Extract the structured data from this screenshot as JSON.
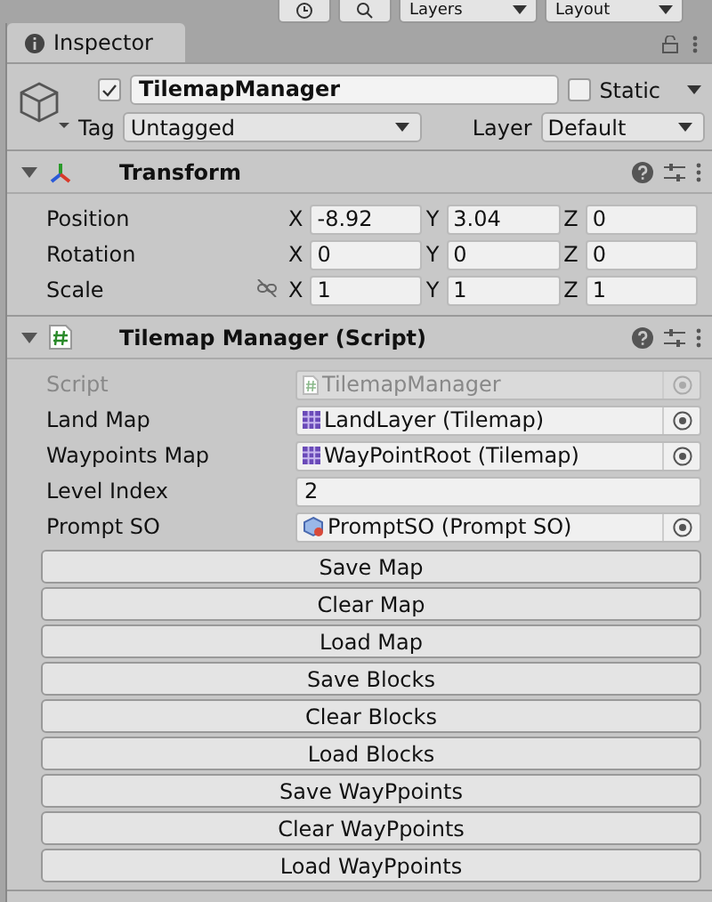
{
  "toolbar": {
    "dropdowns": [
      "Layers",
      "Layout"
    ]
  },
  "tab": {
    "label": "Inspector"
  },
  "object": {
    "active": true,
    "name": "TilemapManager",
    "static": false,
    "static_label": "Static",
    "tag_label": "Tag",
    "tag": "Untagged",
    "layer_label": "Layer",
    "layer": "Default"
  },
  "components": [
    {
      "kind": "transform",
      "title": "Transform",
      "expanded": true,
      "rows": [
        {
          "label": "Position",
          "values": [
            {
              "axis": "X",
              "value": "-8.92"
            },
            {
              "axis": "Y",
              "value": "3.04"
            },
            {
              "axis": "Z",
              "value": "0"
            }
          ]
        },
        {
          "label": "Rotation",
          "values": [
            {
              "axis": "X",
              "value": "0"
            },
            {
              "axis": "Y",
              "value": "0"
            },
            {
              "axis": "Z",
              "value": "0"
            }
          ]
        },
        {
          "label": "Scale",
          "proportions_locked": false,
          "values": [
            {
              "axis": "X",
              "value": "1"
            },
            {
              "axis": "Y",
              "value": "1"
            },
            {
              "axis": "Z",
              "value": "1"
            }
          ]
        }
      ]
    },
    {
      "kind": "script",
      "title": "Tilemap Manager (Script)",
      "expanded": true,
      "fields": [
        {
          "label": "Script",
          "kind": "script",
          "value": "TilemapManager",
          "disabled": true
        },
        {
          "label": "Land Map",
          "kind": "tilemap",
          "value": "LandLayer (Tilemap)",
          "disabled": false
        },
        {
          "label": "Waypoints Map",
          "kind": "tilemap",
          "value": "WayPointRoot (Tilemap)",
          "disabled": false
        },
        {
          "label": "Level Index",
          "kind": "number",
          "value": "2",
          "disabled": false
        },
        {
          "label": "Prompt SO",
          "kind": "asset",
          "value": "PromptSO (Prompt SO)",
          "disabled": false
        }
      ],
      "buttons": [
        "Save Map",
        "Clear Map",
        "Load Map",
        "Save Blocks",
        "Clear Blocks",
        "Load Blocks",
        "Save WayPpoints",
        "Clear WayPpoints",
        "Load WayPpoints"
      ]
    }
  ]
}
